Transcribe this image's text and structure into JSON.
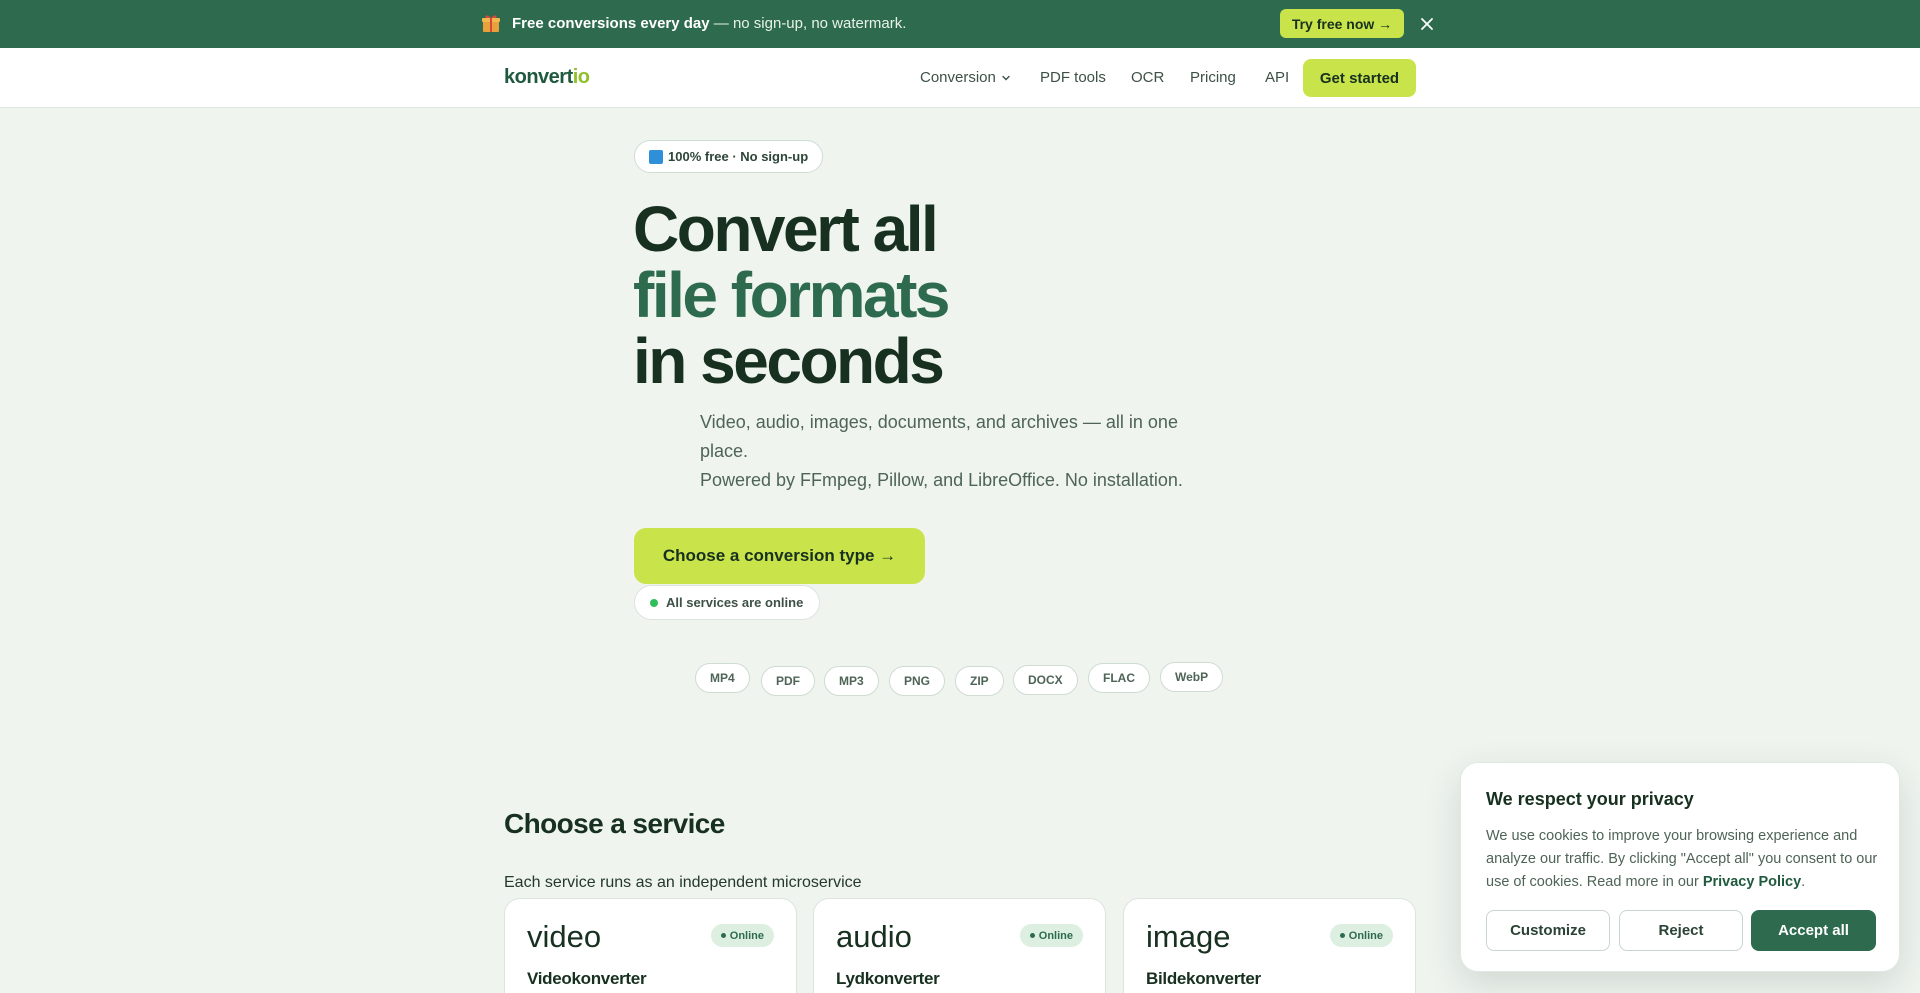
{
  "promo": {
    "bold": "Free conversions every day",
    "rest": " — no sign-up, no watermark.",
    "cta": "Try free now →"
  },
  "nav": {
    "logo_main": "konvert",
    "logo_accent": "io",
    "links": [
      "Conversion",
      "PDF tools",
      "OCR",
      "Pricing",
      "API"
    ],
    "cta": "Get started"
  },
  "hero": {
    "badge": "100% free · No sign-up",
    "title_line1": "Convert all",
    "title_line2": "file formats",
    "title_line3": "in seconds",
    "subtitle_line1": "Video, audio, images, documents, and archives — all in one place.",
    "subtitle_line2": "Powered by FFmpeg, Pillow, and LibreOffice. No installation.",
    "cta": "Choose a conversion type →",
    "status": "All services are online",
    "formats": [
      "MP4",
      "PDF",
      "MP3",
      "PNG",
      "ZIP",
      "DOCX",
      "FLAC",
      "WebP"
    ]
  },
  "services": {
    "title": "Choose a service",
    "subtitle": "Each service runs as an independent microservice",
    "cards": [
      {
        "name": "video",
        "title": "Videokonverter",
        "status": "Online"
      },
      {
        "name": "audio",
        "title": "Lydkonverter",
        "status": "Online"
      },
      {
        "name": "image",
        "title": "Bildekonverter",
        "status": "Online"
      }
    ]
  },
  "cookie": {
    "title": "We respect your privacy",
    "text": "We use cookies to improve your browsing experience and analyze our traffic. By clicking \"Accept all\" you consent to our use of cookies. Read more in our ",
    "link": "Privacy Policy",
    "text_end": ".",
    "customize": "Customize",
    "reject": "Reject",
    "accept": "Accept all"
  },
  "colors": {
    "brand_dark": "#2e6b4e",
    "accent_lime": "#c9e44a",
    "background": "#eff4ef",
    "online": "#2fbf5a"
  }
}
